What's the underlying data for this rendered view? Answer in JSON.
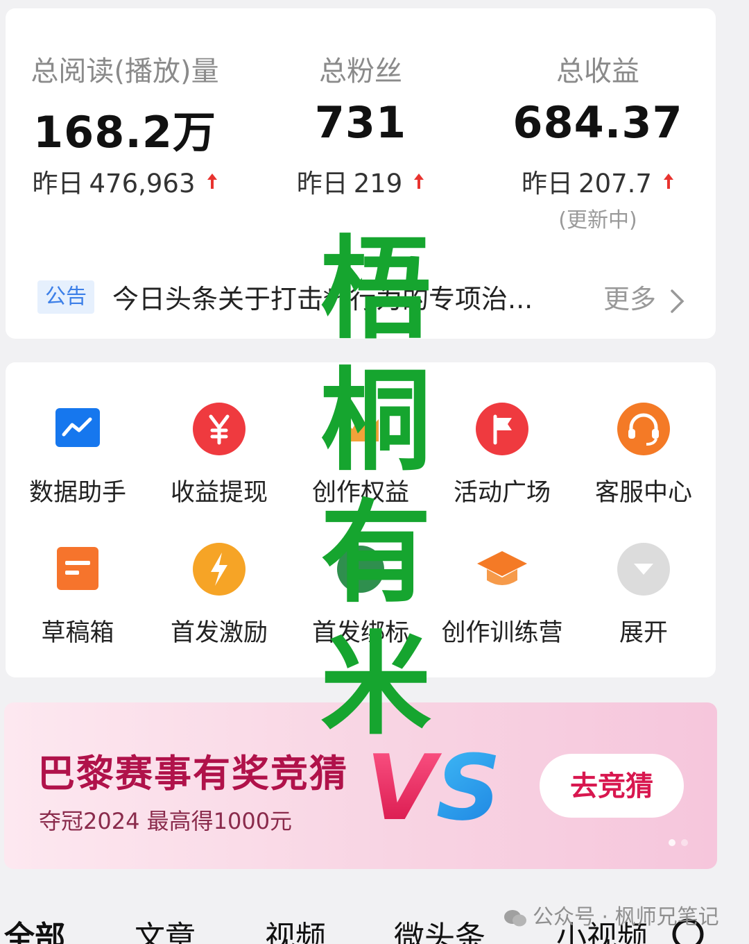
{
  "stats": [
    {
      "label": "总阅读(播放)量",
      "value": "168.2万",
      "yesterday_label": "昨日",
      "yesterday_value": "476,963",
      "note": ""
    },
    {
      "label": "总粉丝",
      "value": "731",
      "yesterday_label": "昨日",
      "yesterday_value": "219",
      "note": ""
    },
    {
      "label": "总收益",
      "value": "684.37",
      "yesterday_label": "昨日",
      "yesterday_value": "207.7",
      "note": "(更新中)"
    }
  ],
  "notice": {
    "tag": "公告",
    "text": "今日头条关于打击**行为的专项治...",
    "more": "更多"
  },
  "tools": [
    {
      "label": "数据助手",
      "icon": "data-chart-icon"
    },
    {
      "label": "收益提现",
      "icon": "yuan-icon"
    },
    {
      "label": "创作权益",
      "icon": "crown-icon"
    },
    {
      "label": "活动广场",
      "icon": "flag-icon"
    },
    {
      "label": "客服中心",
      "icon": "headset-icon"
    },
    {
      "label": "草稿箱",
      "icon": "draft-box-icon"
    },
    {
      "label": "首发激励",
      "icon": "lightning-icon"
    },
    {
      "label": "首发绑标",
      "icon": "badge-icon"
    },
    {
      "label": "创作训练营",
      "icon": "graduation-cap-icon"
    },
    {
      "label": "展开",
      "icon": "chevron-down-icon"
    }
  ],
  "banner": {
    "title": "巴黎赛事有奖竞猜",
    "subtitle": "夺冠2024 最高得1000元",
    "vs": "VS",
    "button": "去竞猜"
  },
  "tabs": [
    "全部",
    "文章",
    "视频",
    "微头条",
    "小视频"
  ],
  "watermark": {
    "overlay": "梧桐有米",
    "channel": "公众号 · 枫师兄笔记"
  },
  "colors": {
    "arrow_up": "#e8332f",
    "notice_tag_bg": "#e6f0fd",
    "notice_tag_text": "#3c7fe8",
    "banner_title": "#b0124a",
    "banner_button_text": "#d8174f",
    "watermark_green": "#16a52f"
  }
}
